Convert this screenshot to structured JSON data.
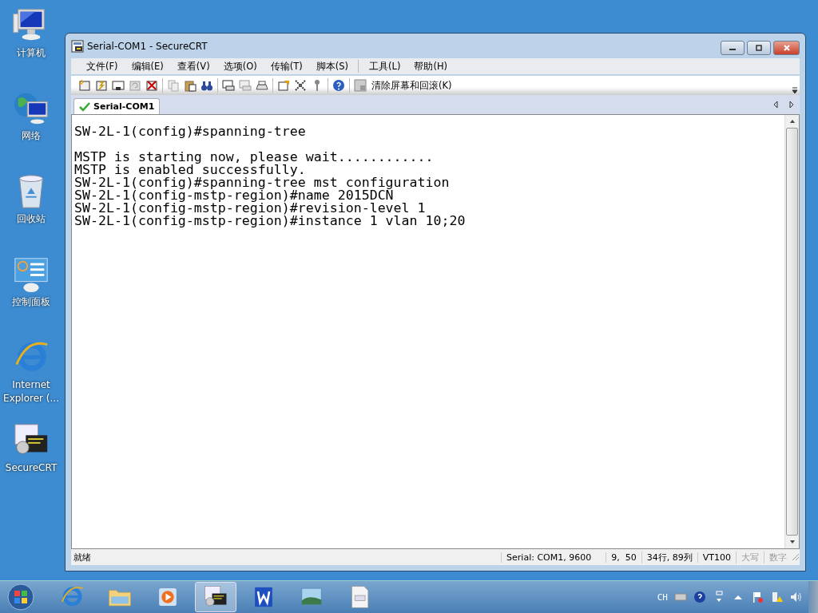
{
  "desktop_icons": [
    {
      "kind": "computer",
      "label": "计算机"
    },
    {
      "kind": "network",
      "label": "网络"
    },
    {
      "kind": "recycle",
      "label": "回收站"
    },
    {
      "kind": "control",
      "label": "控制面板"
    },
    {
      "kind": "ie",
      "label": "Internet Explorer (..."
    },
    {
      "kind": "securecrt",
      "label": "SecureCRT"
    }
  ],
  "window": {
    "title": "Serial-COM1 - SecureCRT",
    "menu": [
      "文件(F)",
      "编辑(E)",
      "查看(V)",
      "选项(O)",
      "传输(T)",
      "脚本(S)",
      "工具(L)",
      "帮助(H)"
    ],
    "toolbar_button": "清除屏幕和回滚(K)",
    "tabs": [
      {
        "label": "Serial-COM1",
        "selected": true,
        "connected": true
      }
    ],
    "terminal_blocks": [
      [
        "SW-2L-1(config)#spanning-tree"
      ],
      [
        "MSTP is starting now, please wait............",
        "MSTP is enabled successfully.",
        "SW-2L-1(config)#spanning-tree mst configuration",
        "SW-2L-1(config-mstp-region)#name 2015DCN",
        "SW-2L-1(config-mstp-region)#revision-level 1",
        "SW-2L-1(config-mstp-region)#instance 1 vlan 10;20"
      ]
    ],
    "status_bar": [
      {
        "text": "就绪",
        "kind": "message",
        "on": true
      },
      {
        "text": "Serial: COM1, 9600",
        "kind": "field",
        "on": true
      },
      {
        "text": "9,  50",
        "kind": "field",
        "on": true
      },
      {
        "text": "34行, 89列",
        "kind": "field",
        "on": true
      },
      {
        "text": "VT100",
        "kind": "field",
        "on": true
      },
      {
        "text": "大写",
        "kind": "indicator",
        "on": false
      },
      {
        "text": "数字",
        "kind": "indicator",
        "on": false
      }
    ]
  },
  "taskbar": {
    "items": [
      {
        "kind": "ie",
        "selected": false
      },
      {
        "kind": "folder",
        "selected": false
      },
      {
        "kind": "media",
        "selected": false
      },
      {
        "kind": "securecrt",
        "selected": true
      },
      {
        "kind": "wps",
        "selected": false
      },
      {
        "kind": "photo",
        "selected": false
      },
      {
        "kind": "doc",
        "selected": false
      }
    ],
    "language": "CH"
  }
}
